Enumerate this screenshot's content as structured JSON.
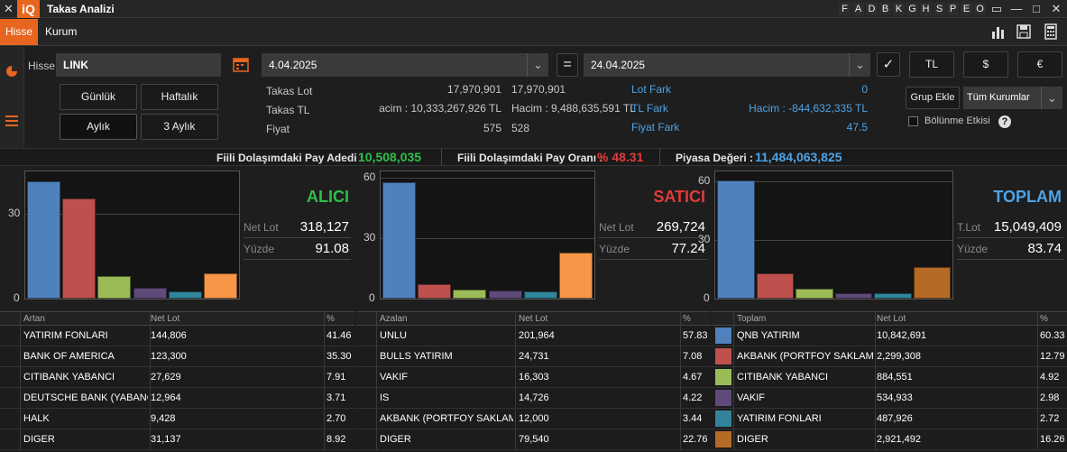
{
  "window": {
    "close_glyph": "✕",
    "logo": "iQ",
    "title": "Takas Analizi",
    "hotkeys": [
      "F",
      "A",
      "D",
      "B",
      "K",
      "G",
      "H",
      "S",
      "P",
      "E",
      "O"
    ],
    "controls": [
      "▭",
      "—",
      "□",
      "✕"
    ]
  },
  "tabs": [
    "Hisse",
    "Kurum"
  ],
  "toolbar_icons": [
    "bar-chart-icon",
    "save-icon",
    "calculator-icon"
  ],
  "form": {
    "hisse_label": "Hisse",
    "hisse_value": "LINK",
    "start_date": "4.04.2025",
    "eq_sign": "=",
    "end_date": "24.04.2025",
    "currency_buttons": [
      "TL",
      "$",
      "€"
    ],
    "period_buttons": [
      "Günlük",
      "Haftalık",
      "Aylık",
      "3 Aylık"
    ],
    "selected_period": "Aylık",
    "group_add": "Grup Ekle",
    "institutions": "Tüm Kurumlar",
    "split_effect": "Bölünme Etkisi",
    "help": "?"
  },
  "summary": {
    "takas_lot": {
      "label": "Takas Lot",
      "v1": "17,970,901",
      "v2": "17,970,901"
    },
    "takas_tl": {
      "label": "Takas TL",
      "v1": "acim : 10,333,267,926 TL",
      "v2": "Hacim : 9,488,635,591 TL"
    },
    "fiyat": {
      "label": "Fiyat",
      "v1": "575",
      "v2": "528"
    },
    "lot_fark": {
      "label": "Lot Fark",
      "value": "0"
    },
    "tl_fark": {
      "label": "TL Fark",
      "value": "Hacim : -844,632,335 TL"
    },
    "fiyat_fark": {
      "label": "Fiyat Fark",
      "value": "47.5"
    }
  },
  "float_bar": {
    "pay_adedi_label": "Fiili Dolaşımdaki Pay Adedi :",
    "pay_adedi": "10,508,035",
    "pay_orani_label": "Fiili Dolaşımdaki Pay Oranı :",
    "pay_orani": "% 48.31",
    "piyasa_label": "Piyasa Değeri :",
    "piyasa": "11,484,063,825"
  },
  "colors": {
    "accent": "#e8651f",
    "green": "#2fbf4a",
    "red": "#e23b3b",
    "blue": "#4da3e6",
    "bar_series": [
      "#4f81bd",
      "#c0504d",
      "#9bbb59",
      "#604a7b",
      "#31849b",
      "#f79646"
    ],
    "bar_series_total": [
      "#4f81bd",
      "#c0504d",
      "#9bbb59",
      "#604a7b",
      "#31849b",
      "#b56a26"
    ]
  },
  "chart_data": [
    {
      "type": "bar",
      "title": "ALICI",
      "categories": [
        "YATIRIM FONLARI",
        "BANK OF AMERICA",
        "CITIBANK YABANCI",
        "DEUTSCHE BANK (YABANCI)",
        "HALK",
        "DIGER"
      ],
      "values": [
        41.46,
        35.3,
        7.91,
        3.71,
        2.7,
        8.92
      ],
      "ylim": [
        0,
        45
      ],
      "yticks": [
        0,
        30
      ],
      "stat1_label": "Net Lot",
      "stat1_value": "318,127",
      "stat2_label": "Yüzde",
      "stat2_value": "91.08"
    },
    {
      "type": "bar",
      "title": "SATICI",
      "categories": [
        "UNLU",
        "BULLS YATIRIM",
        "VAKIF",
        "IS",
        "AKBANK (PORTFOY SAKLAMA)",
        "DIGER"
      ],
      "values": [
        57.83,
        7.08,
        4.67,
        4.22,
        3.44,
        22.76
      ],
      "ylim": [
        0,
        63
      ],
      "yticks": [
        0,
        30,
        60
      ],
      "stat1_label": "Net Lot",
      "stat1_value": "269,724",
      "stat2_label": "Yüzde",
      "stat2_value": "77.24"
    },
    {
      "type": "bar",
      "title": "TOPLAM",
      "categories": [
        "QNB YATIRIM",
        "AKBANK (PORTFOY SAKLAMA)",
        "CITIBANK YABANCI",
        "VAKIF",
        "YATIRIM FONLARI",
        "DIGER"
      ],
      "values": [
        60.33,
        12.79,
        4.92,
        2.98,
        2.72,
        16.26
      ],
      "ylim": [
        0,
        65
      ],
      "yticks": [
        0,
        30,
        60
      ],
      "stat1_label": "T.Lot",
      "stat1_value": "15,049,409",
      "stat2_label": "Yüzde",
      "stat2_value": "83.74"
    }
  ],
  "tables": [
    {
      "headers": [
        "Artan",
        "Net Lot",
        "%"
      ],
      "rows": [
        [
          "YATIRIM FONLARI",
          "144,806",
          "41.46"
        ],
        [
          "BANK OF AMERICA",
          "123,300",
          "35.30"
        ],
        [
          "CITIBANK YABANCI",
          "27,629",
          "7.91"
        ],
        [
          "DEUTSCHE BANK (YABANCI)",
          "12,964",
          "3.71"
        ],
        [
          "HALK",
          "9,428",
          "2.70"
        ],
        [
          "DIGER",
          "31,137",
          "8.92"
        ]
      ]
    },
    {
      "headers": [
        "Azalan",
        "Net Lot",
        "%"
      ],
      "rows": [
        [
          "UNLU",
          "201,964",
          "57.83"
        ],
        [
          "BULLS YATIRIM",
          "24,731",
          "7.08"
        ],
        [
          "VAKIF",
          "16,303",
          "4.67"
        ],
        [
          "IS",
          "14,726",
          "4.22"
        ],
        [
          "AKBANK (PORTFOY SAKLAMA)",
          "12,000",
          "3.44"
        ],
        [
          "DIGER",
          "79,540",
          "22.76"
        ]
      ]
    },
    {
      "headers": [
        "Toplam",
        "Net Lot",
        "%"
      ],
      "rows": [
        [
          "QNB YATIRIM",
          "10,842,691",
          "60.33"
        ],
        [
          "AKBANK (PORTFOY SAKLAMA)",
          "2,299,308",
          "12.79"
        ],
        [
          "CITIBANK YABANCI",
          "884,551",
          "4.92"
        ],
        [
          "VAKIF",
          "534,933",
          "2.98"
        ],
        [
          "YATIRIM FONLARI",
          "487,926",
          "2.72"
        ],
        [
          "DIGER",
          "2,921,492",
          "16.26"
        ]
      ]
    }
  ]
}
